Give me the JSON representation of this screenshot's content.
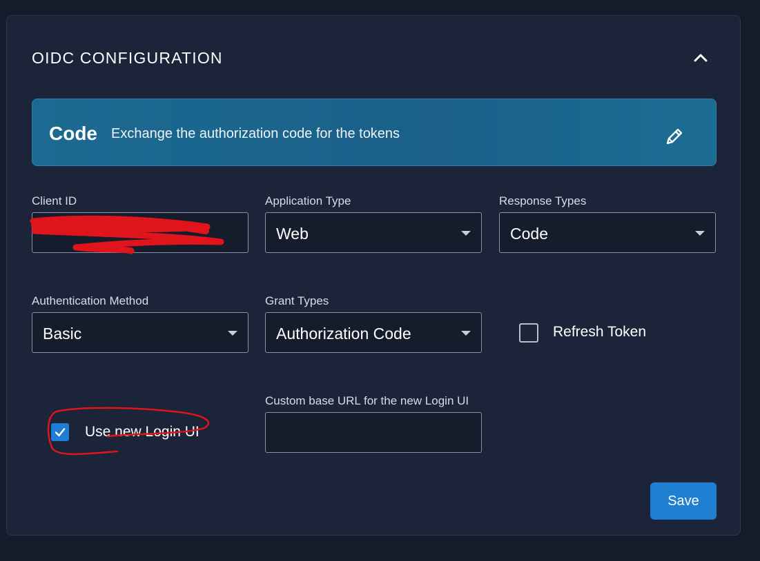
{
  "section": {
    "title": "OIDC CONFIGURATION",
    "collapse_icon": "chevron-up-icon"
  },
  "banner": {
    "title": "Code",
    "description": "Exchange the authorization code for the tokens",
    "edit_icon": "pencil-icon"
  },
  "fields": {
    "client_id": {
      "label": "Client ID",
      "value": ""
    },
    "application_type": {
      "label": "Application Type",
      "value": "Web"
    },
    "response_types": {
      "label": "Response Types",
      "value": "Code"
    },
    "authentication_method": {
      "label": "Authentication Method",
      "value": "Basic"
    },
    "grant_types": {
      "label": "Grant Types",
      "value": "Authorization Code"
    },
    "refresh_token": {
      "label": "Refresh Token",
      "checked": false
    },
    "use_new_login_ui": {
      "label": "Use new Login UI",
      "checked": true
    },
    "custom_base_url": {
      "label": "Custom base URL for the new Login UI",
      "value": ""
    }
  },
  "actions": {
    "save_label": "Save"
  },
  "colors": {
    "background": "#141b2a",
    "card": "#1b2438",
    "banner": "#1c6a91",
    "accent": "#1f7fd0",
    "annotation_red": "#e0141b"
  }
}
